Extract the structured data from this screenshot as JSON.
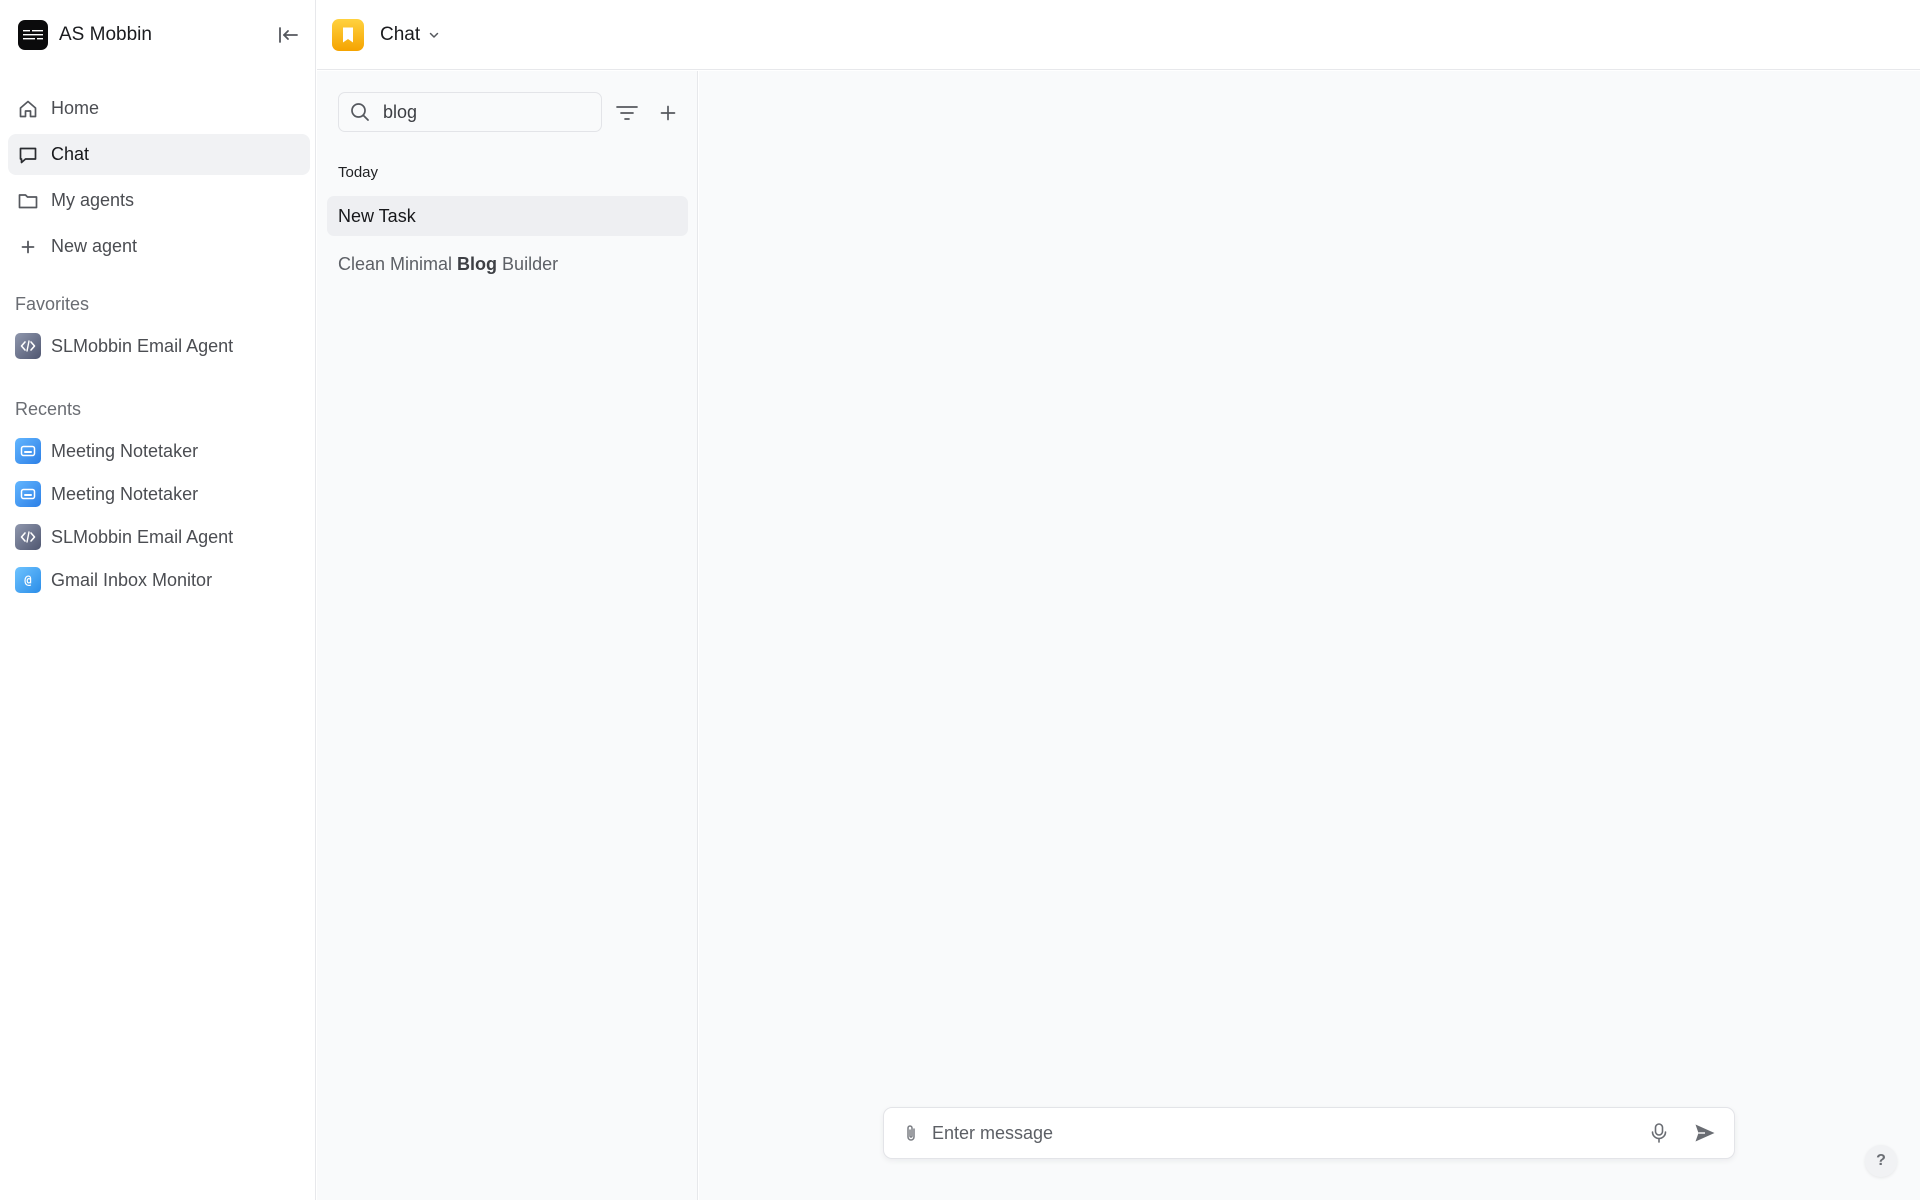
{
  "workspace": {
    "name": "AS Mobbin",
    "logo_text": "AS Mobbin"
  },
  "nav": {
    "items": [
      {
        "label": "Home",
        "icon": "home-icon"
      },
      {
        "label": "Chat",
        "icon": "chat-bubble-icon",
        "active": true
      },
      {
        "label": "My agents",
        "icon": "folder-icon"
      },
      {
        "label": "New agent",
        "icon": "plus-icon"
      }
    ]
  },
  "favorites": {
    "label": "Favorites",
    "items": [
      {
        "label": "SLMobbin Email Agent",
        "icon": "code-icon"
      }
    ]
  },
  "recents": {
    "label": "Recents",
    "items": [
      {
        "label": "Meeting Notetaker",
        "icon": "meeting-icon"
      },
      {
        "label": "Meeting Notetaker",
        "icon": "meeting-icon"
      },
      {
        "label": "SLMobbin Email Agent",
        "icon": "code-icon"
      },
      {
        "label": "Gmail Inbox Monitor",
        "icon": "at-sign-icon"
      }
    ]
  },
  "topbar": {
    "title": "Chat",
    "badge_icon": "bookmark-icon"
  },
  "conversations": {
    "search_value": "blog",
    "group_label": "Today",
    "items": [
      {
        "label": "New Task",
        "active": true
      },
      {
        "label_prefix": "Clean Minimal ",
        "label_match": "Blog",
        "label_suffix": " Builder"
      }
    ]
  },
  "composer": {
    "placeholder": "Enter message"
  },
  "help": {
    "label": "?"
  },
  "colors": {
    "accent_yellow": "#f5a300",
    "active_bg": "#f1f2f4",
    "panel_bg": "#f9fafb",
    "border": "#e7e8eb"
  }
}
